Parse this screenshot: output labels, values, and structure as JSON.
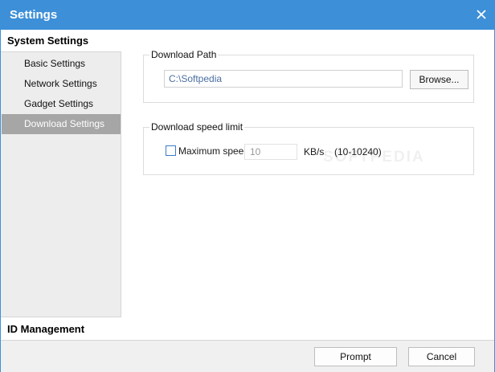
{
  "window": {
    "title": "Settings",
    "accent_color": "#3d8fd8",
    "close_icon": "close-icon"
  },
  "sidebar": {
    "section_title": "System Settings",
    "items": [
      {
        "label": "Basic Settings",
        "selected": false
      },
      {
        "label": "Network Settings",
        "selected": false
      },
      {
        "label": "Gadget Settings",
        "selected": false
      },
      {
        "label": "Download Settings",
        "selected": true
      }
    ],
    "bottom_section": "ID Management"
  },
  "download_path": {
    "group_title": "Download Path",
    "path_value": "C:\\Softpedia",
    "browse_label": "Browse..."
  },
  "speed_limit": {
    "group_title": "Download speed limit",
    "checkbox_label": "Maximum speed",
    "checked": false,
    "speed_value": "10",
    "unit": "KB/s",
    "range": "(10-10240)"
  },
  "watermark": "SOFTPEDIA",
  "footer": {
    "prompt_label": "Prompt",
    "cancel_label": "Cancel"
  }
}
